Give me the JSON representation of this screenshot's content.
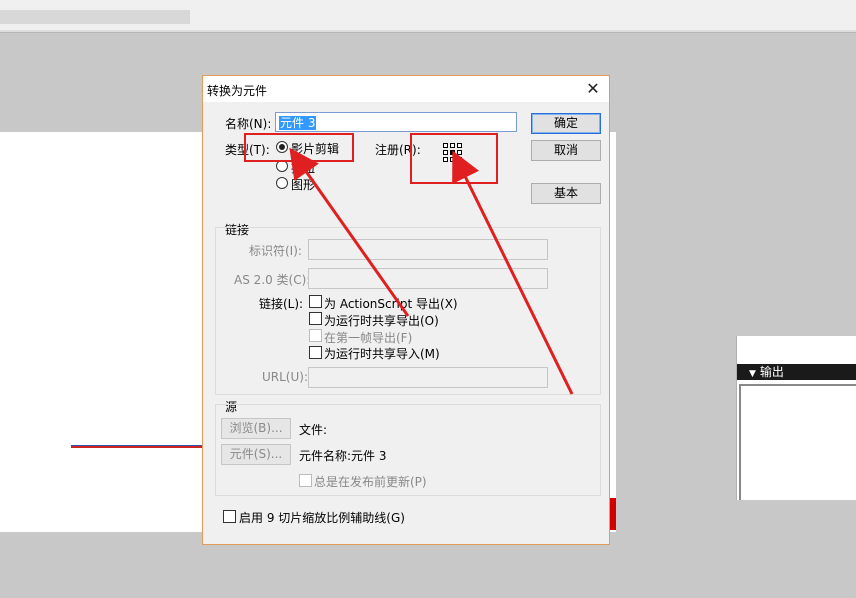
{
  "dialog": {
    "title": "转换为元件",
    "name_label": "名称(N):",
    "name_value": "元件 3",
    "type_label": "类型(T):",
    "types": [
      {
        "label": "影片剪辑",
        "selected": true
      },
      {
        "label": "按钮",
        "selected": false
      },
      {
        "label": "图形",
        "selected": false
      }
    ],
    "registration_label": "注册(R):",
    "buttons": {
      "ok": "确定",
      "cancel": "取消",
      "basic": "基本"
    },
    "linkage": {
      "section_title": "链接",
      "identifier_label": "标识符(I):",
      "identifier_value": "",
      "as_class_label": "AS 2.0 类(C):",
      "as_class_value": "",
      "linkage_label": "链接(L):",
      "options": [
        {
          "label": "为 ActionScript 导出(X)",
          "checked": false,
          "enabled": true
        },
        {
          "label": "为运行时共享导出(O)",
          "checked": false,
          "enabled": true
        },
        {
          "label": "在第一帧导出(F)",
          "checked": false,
          "enabled": false
        },
        {
          "label": "为运行时共享导入(M)",
          "checked": false,
          "enabled": true
        }
      ],
      "url_label": "URL(U):",
      "url_value": ""
    },
    "source": {
      "section_title": "源",
      "browse_button": "浏览(B)...",
      "symbol_button": "元件(S)...",
      "file_text": "文件:",
      "symbol_name_text": "元件名称:元件 3",
      "update_option": "总是在发布前更新(P)"
    },
    "nine_slice_option": "启用 9 切片缩放比例辅助线(G)"
  },
  "output_panel": {
    "title": "输出"
  },
  "colors": {
    "annotation": "#e02020",
    "dialog_border": "#e39b5a",
    "selection": "#3399ff"
  }
}
